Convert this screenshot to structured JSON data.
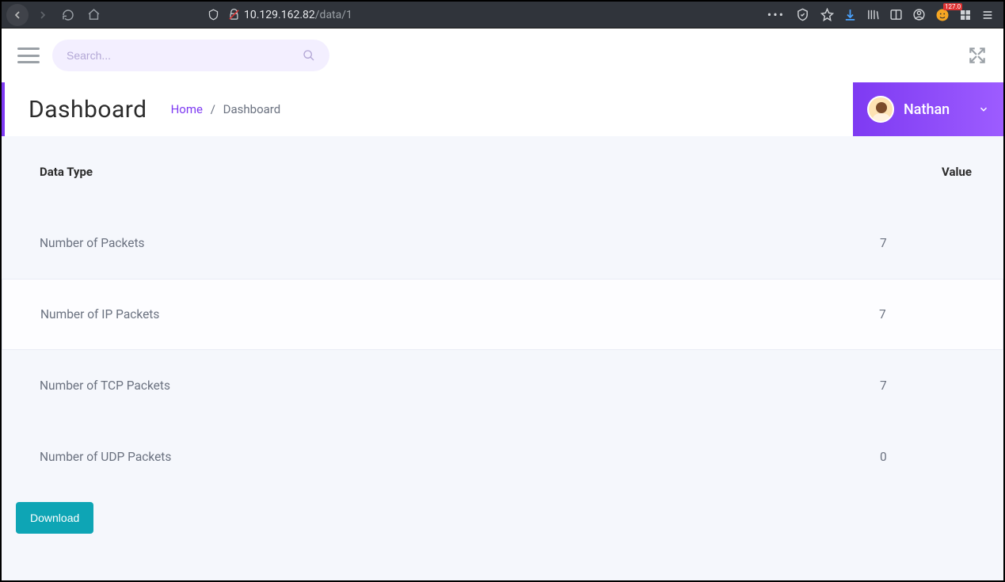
{
  "browser": {
    "url_host": "10.129.162.82",
    "url_path": "/data/1",
    "toolbar_badge": "127.0"
  },
  "search": {
    "placeholder": "Search..."
  },
  "header": {
    "title": "Dashboard",
    "breadcrumb_home": "Home",
    "breadcrumb_current": "Dashboard"
  },
  "user": {
    "name": "Nathan"
  },
  "table": {
    "headers": {
      "type": "Data Type",
      "value": "Value"
    },
    "rows": [
      {
        "type": "Number of Packets",
        "value": "7",
        "highlight": false
      },
      {
        "type": "Number of IP Packets",
        "value": "7",
        "highlight": true
      },
      {
        "type": "Number of TCP Packets",
        "value": "7",
        "highlight": false
      },
      {
        "type": "Number of UDP Packets",
        "value": "0",
        "highlight": false
      }
    ]
  },
  "actions": {
    "download": "Download"
  }
}
